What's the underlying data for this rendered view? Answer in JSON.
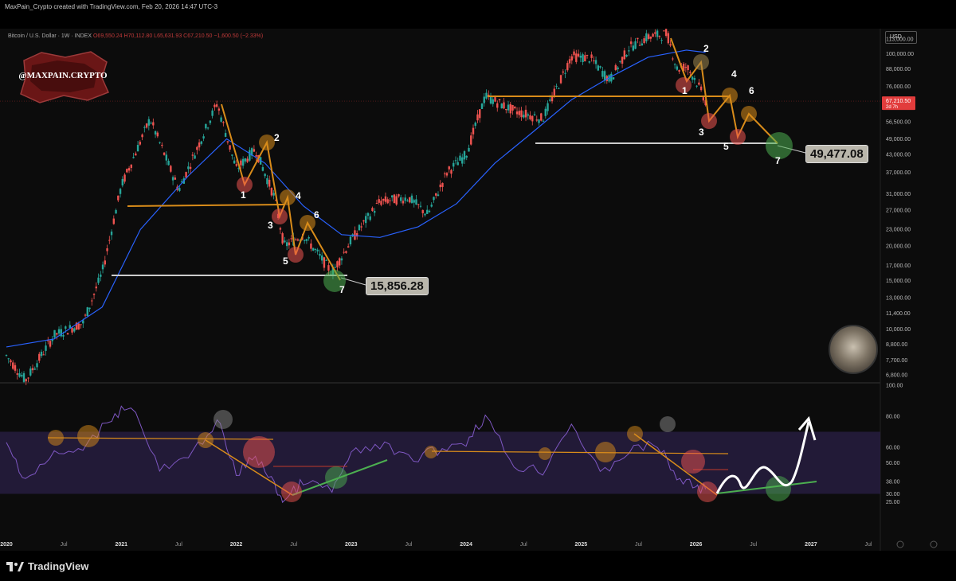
{
  "header": {
    "credit": "MaxPain_Crypto created with TradingView.com, Feb 20, 2026 14:47 UTC-3"
  },
  "legend": {
    "symbol": "Bitcoin / U.S. Dollar · 1W · INDEX",
    "open": "O69,550.24",
    "high": "H70,112.80",
    "low": "L65,631.93",
    "close": "C67,210.50",
    "change": "−1,600.50 (−2.33%)"
  },
  "currency": "USD",
  "watermark": {
    "handle": "@MAXPAIN.CRYPTO"
  },
  "price_tag": {
    "value": "67,210.50",
    "countdown": "2d 7h",
    "color": "#e23c3c"
  },
  "callouts": {
    "low_2022": "15,856.28",
    "target_2026": "49,477.08"
  },
  "wave_labels": {
    "first": [
      "1",
      "2",
      "3",
      "4",
      "5",
      "6",
      "7"
    ],
    "second": [
      "1",
      "2",
      "3",
      "4",
      "5",
      "6",
      "7"
    ]
  },
  "footer": {
    "brand": "TradingView"
  },
  "colors": {
    "bull": "#26a69a",
    "bear": "#ef5350",
    "ma": "#2962ff",
    "orange": "#d98c1a",
    "rsi": "#7e57c2",
    "rsi_band": "#2a1f45",
    "green_trend": "#4caf50"
  },
  "chart_data": [
    {
      "type": "line",
      "title": "Bitcoin / U.S. Dollar · 1W · INDEX",
      "y_scale": "log",
      "ylim": [
        6500,
        120000
      ],
      "yticks": [
        "113,000.00",
        "100,000.00",
        "88,000.00",
        "76,000.00",
        "67,210.50",
        "56,500.00",
        "49,000.00",
        "43,000.00",
        "37,000.00",
        "31,000.00",
        "27,000.00",
        "23,000.00",
        "20,000.00",
        "17,000.00",
        "15,000.00",
        "13,000.00",
        "11,400.00",
        "10,000.00",
        "8,800.00",
        "7,700.00",
        "6,800.00"
      ],
      "xticks": [
        "2020",
        "Jul",
        "2021",
        "Jul",
        "2022",
        "Jul",
        "2023",
        "Jul",
        "2024",
        "Jul",
        "2025",
        "Jul",
        "2026",
        "Jul",
        "2027",
        "Jul"
      ],
      "series": [
        {
          "name": "",
          "role": "price",
          "x": [
            "2020-01",
            "2020-03",
            "2020-06",
            "2020-09",
            "2020-11",
            "2021-01",
            "2021-04",
            "2021-07",
            "2021-09",
            "2021-11",
            "2022-01",
            "2022-03",
            "2022-05",
            "2022-06",
            "2022-08",
            "2022-11",
            "2023-01",
            "2023-04",
            "2023-07",
            "2023-09",
            "2023-11",
            "2024-01",
            "2024-03",
            "2024-06",
            "2024-09",
            "2024-12",
            "2025-02",
            "2025-04",
            "2025-06",
            "2025-08",
            "2025-10",
            "2025-11",
            "2025-12",
            "2026-01",
            "2026-02"
          ],
          "y": [
            8000,
            6500,
            9500,
            10500,
            16000,
            33000,
            58000,
            32000,
            46000,
            66000,
            38000,
            45000,
            30000,
            20000,
            22000,
            16000,
            21000,
            29000,
            30000,
            26000,
            37000,
            43000,
            70000,
            62000,
            58000,
            98000,
            96000,
            80000,
            105000,
            115000,
            118000,
            88000,
            90000,
            80000,
            67210
          ]
        },
        {
          "name": "",
          "role": "moving-average",
          "x": [
            "2020-01",
            "2020-06",
            "2020-11",
            "2021-03",
            "2021-08",
            "2021-12",
            "2022-04",
            "2022-08",
            "2022-12",
            "2023-04",
            "2023-08",
            "2023-12",
            "2024-04",
            "2024-08",
            "2024-12",
            "2025-04",
            "2025-08",
            "2025-12",
            "2026-02"
          ],
          "y": [
            8600,
            9200,
            12000,
            23000,
            36000,
            49000,
            40000,
            28000,
            22000,
            21500,
            23500,
            28500,
            40000,
            52000,
            68000,
            82000,
            97000,
            103000,
            101000
          ]
        }
      ]
    },
    {
      "type": "line",
      "title": "",
      "ylim": [
        20,
        100
      ],
      "yticks": [
        "100.00",
        "80.00",
        "60.00",
        "50.00",
        "38.00",
        "30.00",
        "25.00"
      ],
      "overbought": 70,
      "oversold": 30,
      "series": [
        {
          "name": "",
          "role": "rsi",
          "x": [
            "2020-01",
            "2020-03",
            "2020-06",
            "2020-09",
            "2020-12",
            "2021-02",
            "2021-05",
            "2021-08",
            "2021-11",
            "2022-01",
            "2022-03",
            "2022-05",
            "2022-06",
            "2022-08",
            "2022-11",
            "2023-01",
            "2023-04",
            "2023-07",
            "2023-10",
            "2024-01",
            "2024-03",
            "2024-06",
            "2024-09",
            "2024-12",
            "2025-03",
            "2025-06",
            "2025-09",
            "2025-11",
            "2026-01",
            "2026-02"
          ],
          "y": [
            62,
            40,
            55,
            58,
            80,
            88,
            45,
            52,
            78,
            42,
            55,
            35,
            25,
            38,
            32,
            55,
            62,
            52,
            58,
            64,
            80,
            48,
            45,
            76,
            42,
            58,
            62,
            40,
            35,
            33
          ]
        }
      ]
    }
  ]
}
